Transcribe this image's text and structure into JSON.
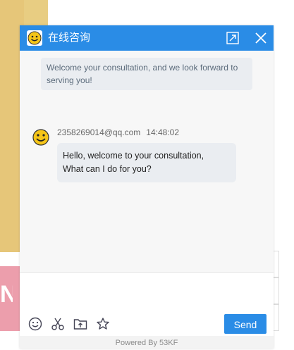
{
  "header": {
    "title": "在线咨询",
    "logo_icon": "smiley-logo-icon",
    "maximize_icon": "maximize-icon",
    "close_icon": "close-icon"
  },
  "messages": {
    "welcome": "Welcome your consultation, and we look forward to serving you!",
    "agent": {
      "name": "2358269014@qq.com",
      "time": "14:48:02",
      "text_line1": "Hello, welcome to your consultation,",
      "text_line2": "What can I do for you?"
    }
  },
  "input": {
    "value": "",
    "toolbar": [
      "emoji-icon",
      "screenshot-scissors-icon",
      "upload-file-icon",
      "favorite-star-icon"
    ],
    "send_label": "Send"
  },
  "footer": {
    "powered": "Powered By 53KF"
  },
  "background": {
    "fragment_letter": "N"
  },
  "colors": {
    "accent": "#2a8ce6",
    "bubble": "#eaedf1",
    "background_yellow": "#e8cd82",
    "background_pink": "#ec9eac"
  }
}
